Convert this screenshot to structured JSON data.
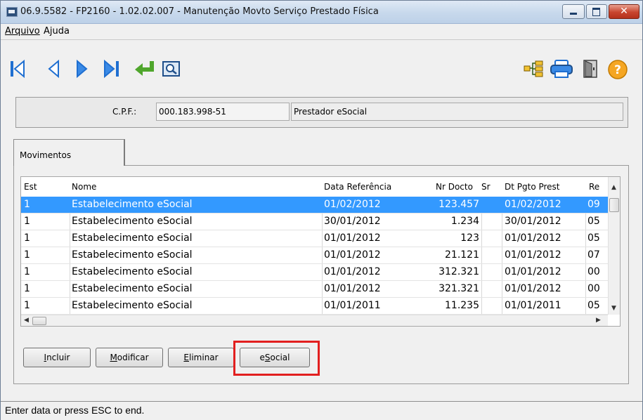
{
  "window": {
    "title": "06.9.5582 - FP2160 - 1.02.02.007 - Manutenção Movto Serviço Prestado Física",
    "close_glyph": "✕"
  },
  "menu": {
    "items": [
      "Arquivo",
      "Ajuda"
    ]
  },
  "toolbar": {
    "left_icons": [
      "first-record-icon",
      "previous-record-icon",
      "next-record-icon",
      "last-record-icon",
      "return-icon",
      "zoom-search-icon"
    ],
    "right_icons": [
      "tree-structure-icon",
      "printer-icon",
      "exit-door-icon",
      "help-icon"
    ]
  },
  "header": {
    "cpf_label": "C.P.F.:",
    "cpf_value": "000.183.998-51",
    "prestador": "Prestador eSocial"
  },
  "tab": {
    "label": "Movimentos"
  },
  "grid": {
    "columns": [
      "Est",
      "Nome",
      "Data Referência",
      "Nr Docto",
      "Sr",
      "Dt Pgto Prest",
      "Re"
    ],
    "rows": [
      [
        "1",
        "Estabelecimento eSocial",
        "01/02/2012",
        "123.457",
        "01/02/2012",
        "09"
      ],
      [
        "1",
        "Estabelecimento eSocial",
        "30/01/2012",
        "1.234",
        "30/01/2012",
        "05"
      ],
      [
        "1",
        "Estabelecimento eSocial",
        "01/01/2012",
        "123",
        "01/01/2012",
        "05"
      ],
      [
        "1",
        "Estabelecimento eSocial",
        "01/01/2012",
        "21.121",
        "01/01/2012",
        "07"
      ],
      [
        "1",
        "Estabelecimento eSocial",
        "01/01/2012",
        "312.321",
        "01/01/2012",
        "00"
      ],
      [
        "1",
        "Estabelecimento eSocial",
        "01/01/2012",
        "321.321",
        "01/01/2012",
        "00"
      ],
      [
        "1",
        "Estabelecimento eSocial",
        "01/01/2011",
        "11.235",
        "01/01/2011",
        "05"
      ]
    ],
    "selected_row": 0
  },
  "buttons": {
    "incluir": {
      "accel": "I",
      "rest": "ncluir"
    },
    "modificar": {
      "accel": "M",
      "rest": "odificar"
    },
    "eliminar": {
      "accel": "E",
      "rest": "liminar"
    },
    "esocial": {
      "pre": "e",
      "accel": "S",
      "rest": "ocial"
    }
  },
  "status": {
    "text": "Enter data or press ESC to end."
  },
  "colors": {
    "selection": "#3399ff",
    "highlight": "#e21f1f",
    "nav_arrow": "#1f6fd1",
    "return_arrow": "#4fa62c"
  }
}
